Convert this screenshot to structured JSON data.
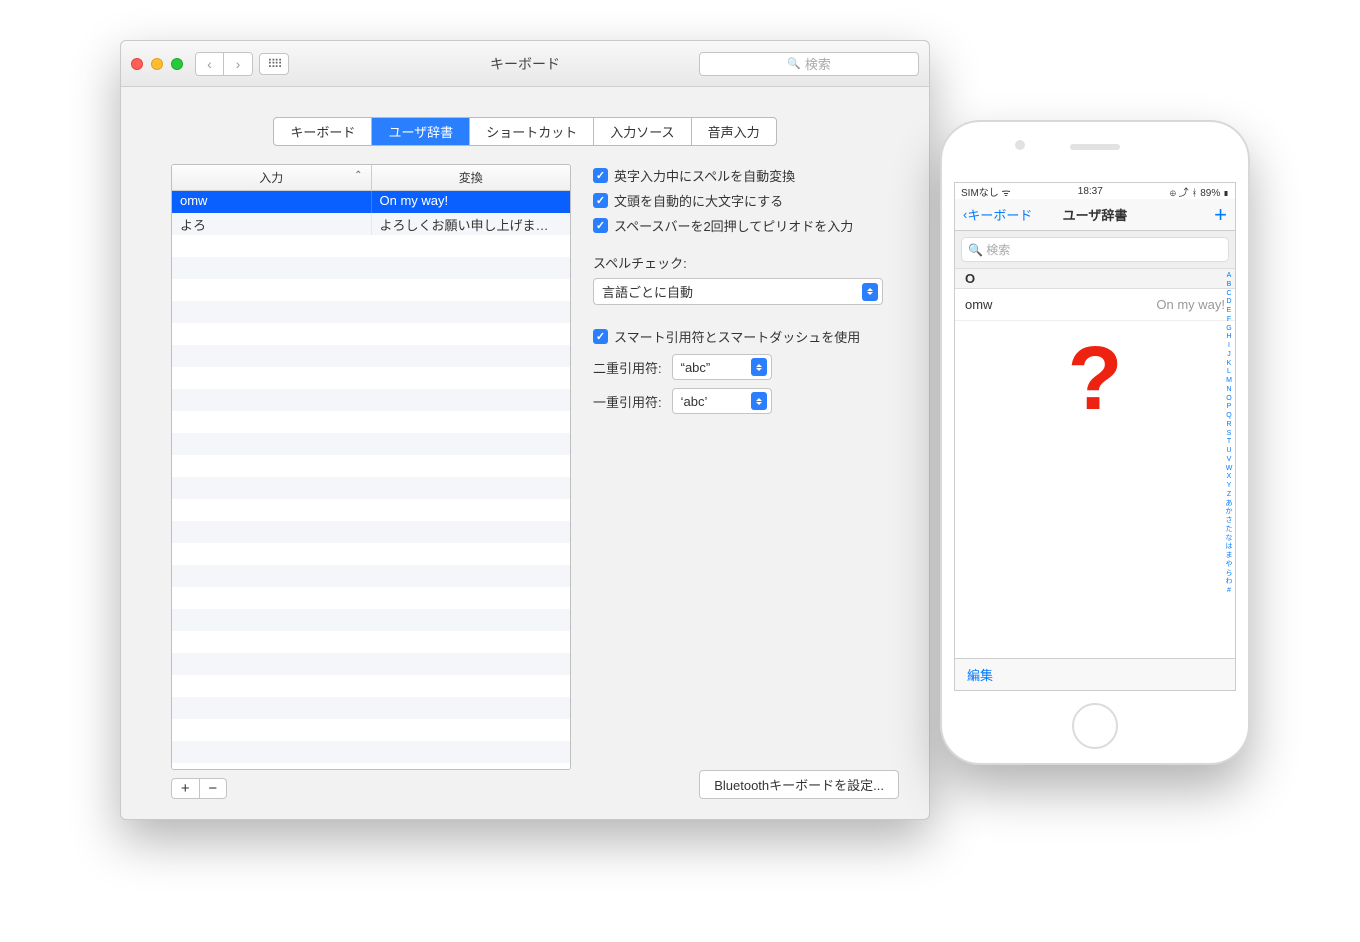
{
  "window": {
    "title": "キーボード",
    "search_placeholder": "検索"
  },
  "tabs": [
    "キーボード",
    "ユーザ辞書",
    "ショートカット",
    "入力ソース",
    "音声入力"
  ],
  "activeTab": 1,
  "table": {
    "headers": [
      "入力",
      "変換"
    ],
    "rows": [
      {
        "input": "omw",
        "output": "On my way!",
        "selected": true
      },
      {
        "input": "よろ",
        "output": "よろしくお願い申し上げま…",
        "selected": false
      }
    ]
  },
  "checks": {
    "spell": "英字入力中にスペルを自動変換",
    "cap": "文頭を自動的に大文字にする",
    "period": "スペースバーを2回押してピリオドを入力"
  },
  "spellcheck": {
    "label": "スペルチェック:",
    "value": "言語ごとに自動"
  },
  "smart": {
    "label": "スマート引用符とスマートダッシュを使用",
    "dbl_label": "二重引用符:",
    "dbl_value": "“abc”",
    "sgl_label": "一重引用符:",
    "sgl_value": "‘abc’"
  },
  "footer_btn": "Bluetoothキーボードを設定...",
  "phone": {
    "status_left": "SIMなし",
    "status_time": "18:37",
    "status_right": "89%",
    "back": "キーボード",
    "title": "ユーザ辞書",
    "plus": "+",
    "search": "検索",
    "section": "O",
    "row_input": "omw",
    "row_output": "On my way!",
    "qmark": "?",
    "edit": "編集",
    "index": [
      "A",
      "B",
      "C",
      "D",
      "E",
      "F",
      "G",
      "H",
      "I",
      "J",
      "K",
      "L",
      "M",
      "N",
      "O",
      "P",
      "Q",
      "R",
      "S",
      "T",
      "U",
      "V",
      "W",
      "X",
      "Y",
      "Z",
      "あ",
      "か",
      "さ",
      "た",
      "な",
      "は",
      "ま",
      "や",
      "ら",
      "わ",
      "#"
    ]
  }
}
